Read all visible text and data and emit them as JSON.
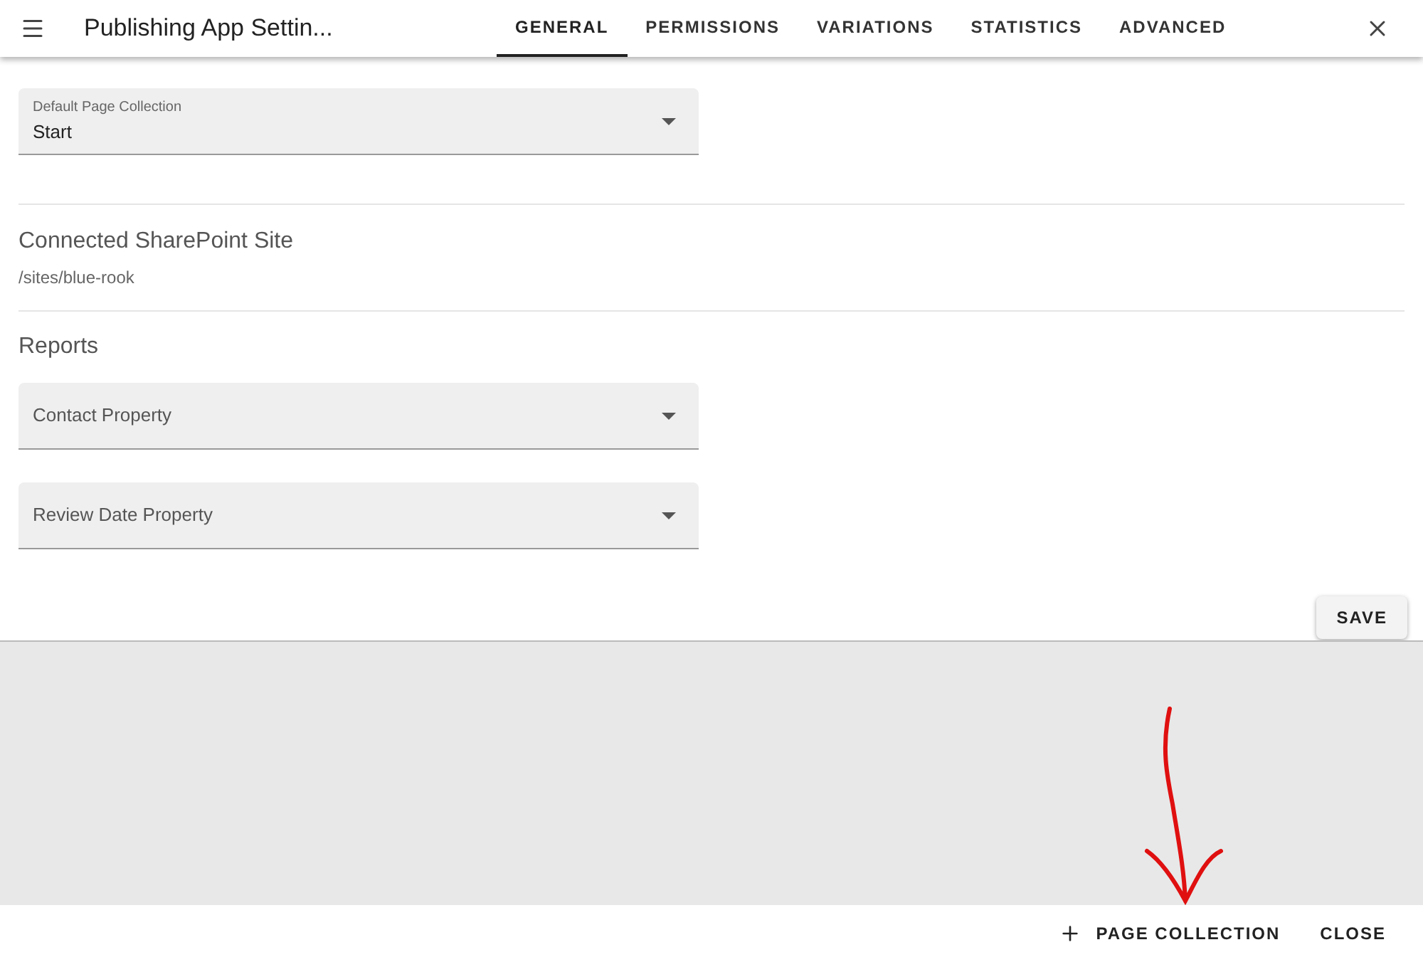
{
  "header": {
    "title": "Publishing App Settin...",
    "tabs": [
      {
        "label": "GENERAL",
        "selected": true
      },
      {
        "label": "PERMISSIONS",
        "selected": false
      },
      {
        "label": "VARIATIONS",
        "selected": false
      },
      {
        "label": "STATISTICS",
        "selected": false
      },
      {
        "label": "ADVANCED",
        "selected": false
      }
    ]
  },
  "default_collection": {
    "label": "Default Page Collection",
    "value": "Start"
  },
  "site": {
    "heading": "Connected SharePoint Site",
    "path": "/sites/blue-rook"
  },
  "reports": {
    "heading": "Reports",
    "fields": [
      {
        "placeholder": "Contact Property"
      },
      {
        "placeholder": "Review Date Property"
      }
    ]
  },
  "save_button": "SAVE",
  "footer": {
    "buttons": [
      {
        "kind": "add",
        "label": "PAGE COLLECTION"
      },
      {
        "kind": "plain",
        "label": "CLOSE"
      }
    ]
  }
}
